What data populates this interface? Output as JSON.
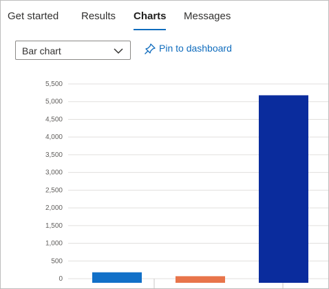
{
  "tabs": [
    {
      "label": "Get started",
      "active": false
    },
    {
      "label": "Results",
      "active": false
    },
    {
      "label": "Charts",
      "active": true
    },
    {
      "label": "Messages",
      "active": false
    }
  ],
  "toolbar": {
    "chart_type_value": "Bar chart",
    "pin_label": "Pin to dashboard"
  },
  "colors": {
    "accent": "#0f6cbd",
    "series": [
      "#1170c8",
      "#e8744a",
      "#0a2c9d"
    ]
  },
  "chart_data": {
    "type": "bar",
    "categories": [
      "",
      "",
      ""
    ],
    "values": [
      180,
      70,
      5180
    ],
    "ylim": [
      0,
      5500
    ],
    "yticks": [
      "0",
      "500",
      "1,000",
      "1,500",
      "2,000",
      "2,500",
      "3,000",
      "3,500",
      "4,000",
      "4,500",
      "5,000",
      "5,500"
    ],
    "grid": true
  }
}
